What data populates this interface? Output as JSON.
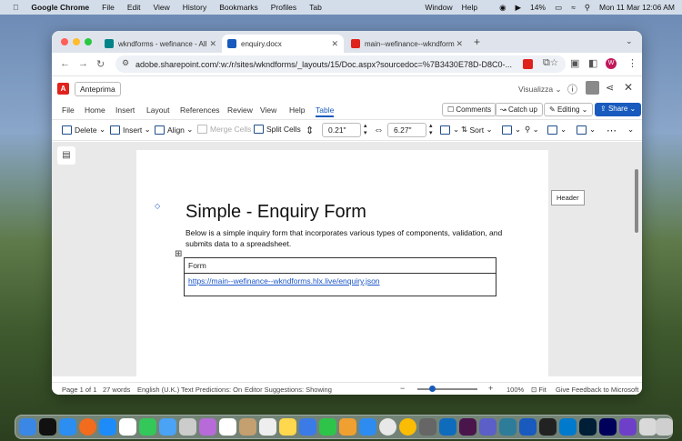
{
  "menubar": {
    "app": "Google Chrome",
    "items": [
      "File",
      "Edit",
      "View",
      "History",
      "Bookmarks",
      "Profiles",
      "Tab"
    ],
    "right_items": [
      "Window",
      "Help"
    ],
    "battery": "14%",
    "clock": "Mon 11 Mar  12:06 AM"
  },
  "tabs": [
    {
      "title": "wkndforms - wefinance - All",
      "icon": "sharepoint-icon",
      "color": "#038387"
    },
    {
      "title": "enquiry.docx",
      "icon": "word-icon",
      "color": "#185abd"
    },
    {
      "title": "main--wefinance--wkndform",
      "icon": "adobe-icon",
      "color": "#e0221c"
    }
  ],
  "address": {
    "url": "adobe.sharepoint.com/:w:/r/sites/wkndforms/_layouts/15/Doc.aspx?sourcedoc=%7B3430E78D-D8C0-..."
  },
  "profile_initial": "W",
  "word": {
    "preview_label": "Anteprima",
    "view_label": "Visualizza",
    "menu_tabs": [
      "File",
      "Home",
      "Insert",
      "Layout",
      "References",
      "Review",
      "View",
      "Help",
      "Table"
    ],
    "active_tab": "Table",
    "comments": "Comments",
    "catchup": "Catch up",
    "editing": "Editing",
    "share": "Share",
    "ribbon": {
      "delete": "Delete",
      "insert": "Insert",
      "align": "Align",
      "merge": "Merge Cells",
      "split": "Split Cells",
      "height": "0.21\"",
      "width": "6.27\"",
      "sort": "Sort"
    },
    "header_tooltip": "Header"
  },
  "document": {
    "title": "Simple - Enquiry Form",
    "description": "Below is a simple inquiry form that incorporates various types of components, validation, and submits data to a spreadsheet.",
    "table": {
      "row1": "Form",
      "row2": "https://main--wefinance--wkndforms.hlx.live/enquiry.json"
    }
  },
  "status": {
    "page": "Page 1 of 1",
    "words": "27 words",
    "language": "English (U.K.)",
    "predictions": "Text Predictions: On",
    "suggestions": "Editor Suggestions: Showing",
    "zoom": "100%",
    "fit": "Fit",
    "feedback": "Give Feedback to Microsoft"
  }
}
